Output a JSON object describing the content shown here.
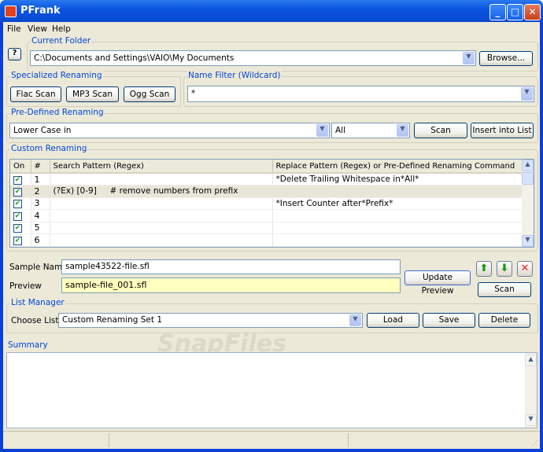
{
  "window": {
    "title": "PFrank",
    "minimize_icon": "minimize-icon",
    "maximize_icon": "maximize-icon",
    "close_icon": "close-icon"
  },
  "menu": {
    "items": [
      "File",
      "View",
      "Help"
    ]
  },
  "help_button": "?",
  "current_folder": {
    "label": "Current Folder",
    "value": "C:\\Documents and Settings\\VAIO\\My Documents",
    "browse": "Browse..."
  },
  "specialized": {
    "label": "Specialized Renaming",
    "buttons": [
      "Flac Scan",
      "MP3 Scan",
      "Ogg Scan"
    ]
  },
  "name_filter": {
    "label": "Name Filter (Wildcard)",
    "value": "*"
  },
  "predefined": {
    "label": "Pre-Defined Renaming",
    "command": "Lower Case in",
    "scope": "All",
    "scan": "Scan",
    "insert": "Insert into List"
  },
  "custom": {
    "label": "Custom Renaming",
    "columns": [
      "On",
      "#",
      "Search Pattern (Regex)",
      "Replace Pattern (Regex)  or  Pre-Defined Renaming Command"
    ],
    "rows": [
      {
        "on": true,
        "num": "1",
        "search": "",
        "replace": "*Delete Trailing Whitespace in*All*"
      },
      {
        "on": true,
        "num": "2",
        "search": "(?Ex) [0-9]     # remove numbers from prefix",
        "replace": ""
      },
      {
        "on": true,
        "num": "3",
        "search": "",
        "replace": "*Insert Counter after*Prefix*"
      },
      {
        "on": true,
        "num": "4",
        "search": "",
        "replace": ""
      },
      {
        "on": true,
        "num": "5",
        "search": "",
        "replace": ""
      },
      {
        "on": true,
        "num": "6",
        "search": "",
        "replace": ""
      }
    ]
  },
  "sample": {
    "label": "Sample Name",
    "value": "sample43522-file.sfl",
    "preview_label": "Preview",
    "preview_value": "sample-file_001.sfl",
    "update_preview": "Update Preview",
    "scan": "Scan",
    "preview_bg": "#ffffc0"
  },
  "list_manager": {
    "label": "List Manager",
    "choose_label": "Choose List:",
    "value": "Custom Renaming Set 1",
    "load": "Load",
    "save": "Save",
    "delete": "Delete"
  },
  "summary": {
    "label": "Summary",
    "value": ""
  },
  "watermark": "SnapFiles"
}
